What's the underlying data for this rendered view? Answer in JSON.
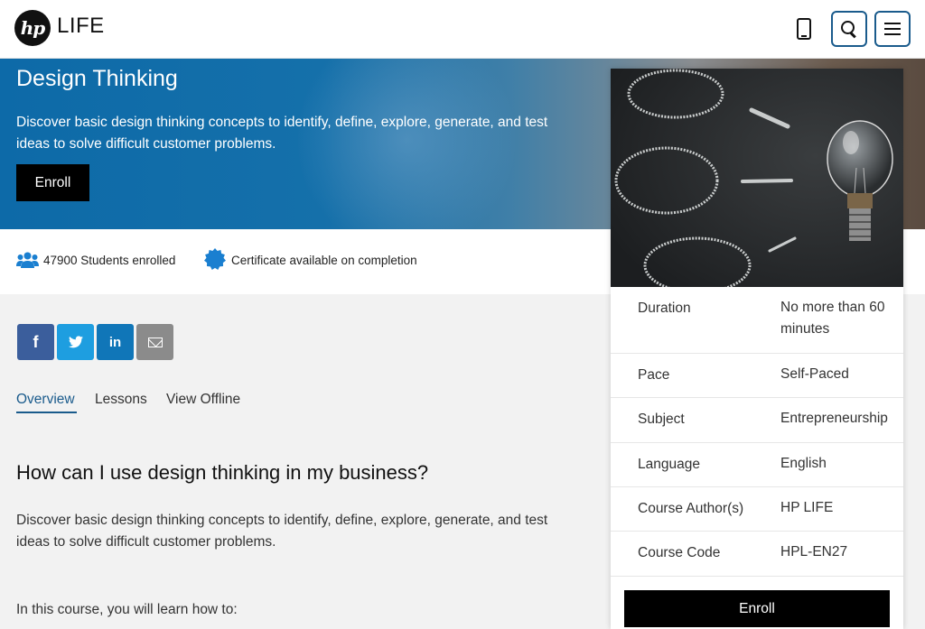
{
  "header": {
    "logo_text": "hp",
    "brand": "LIFE",
    "icons": [
      "phone-icon",
      "search-icon",
      "menu-icon"
    ]
  },
  "hero": {
    "title": "Design Thinking",
    "description": "Discover basic design thinking concepts to identify, define, explore, generate, and test ideas to solve difficult customer problems.",
    "enroll_label": "Enroll"
  },
  "stats": {
    "students": "47900 Students enrolled",
    "certificate": "Certificate available on completion"
  },
  "share": {
    "facebook": "f",
    "linkedin": "in"
  },
  "tabs": [
    {
      "label": "Overview",
      "active": true
    },
    {
      "label": "Lessons",
      "active": false
    },
    {
      "label": "View Offline",
      "active": false
    }
  ],
  "main": {
    "heading": "How can I use design thinking in my business?",
    "description": "Discover basic design thinking concepts to identify, define, explore, generate, and test ideas to solve difficult customer problems.",
    "learn_intro": "In this course, you will learn how to:"
  },
  "course_details": [
    {
      "label": "Duration",
      "value": "No more than 60 minutes"
    },
    {
      "label": "Pace",
      "value": "Self-Paced"
    },
    {
      "label": "Subject",
      "value": "Entrepreneurship"
    },
    {
      "label": "Language",
      "value": "English"
    },
    {
      "label": "Course Author(s)",
      "value": "HP LIFE"
    },
    {
      "label": "Course Code",
      "value": "HPL-EN27"
    }
  ],
  "card": {
    "enroll_label": "Enroll"
  },
  "colors": {
    "accent": "#1a5b8c",
    "hero_blue": "#0d6aa8",
    "facebook": "#3b5e9c",
    "twitter": "#1e9ee0",
    "linkedin": "#1076b8",
    "email": "#8b8b8b"
  }
}
